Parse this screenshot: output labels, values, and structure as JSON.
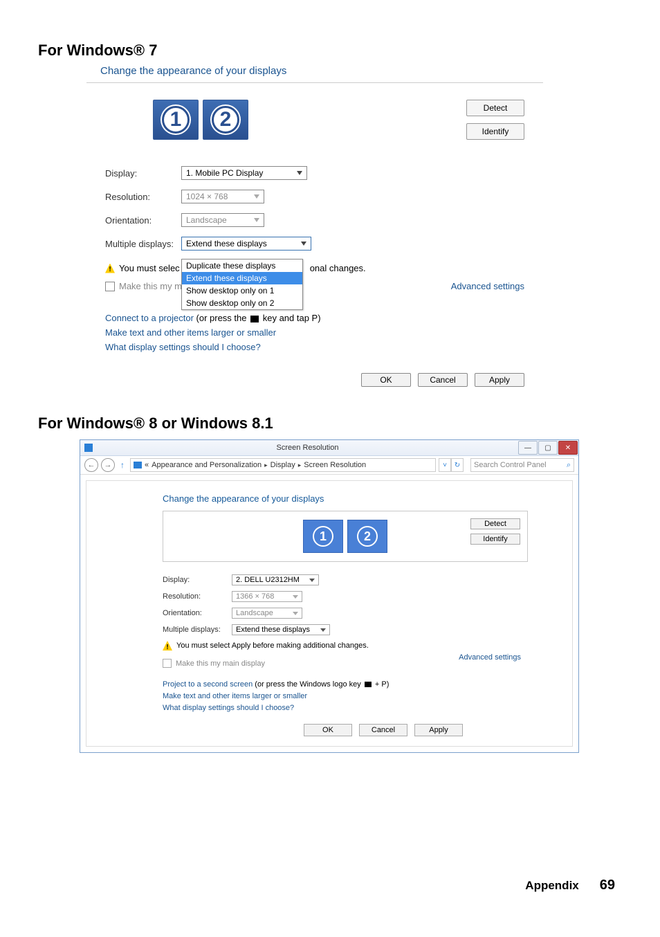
{
  "headings": {
    "win7": "For Windows® 7",
    "win8": "For Windows® 8 or Windows 8.1"
  },
  "win7": {
    "subtitle": "Change the appearance of your displays",
    "detect": "Detect",
    "identify": "Identify",
    "monitor1": "1",
    "monitor2": "2",
    "labels": {
      "display": "Display:",
      "resolution": "Resolution:",
      "orientation": "Orientation:",
      "multiple": "Multiple displays:"
    },
    "display_value": "1. Mobile PC Display",
    "resolution_value": "1024 × 768",
    "orientation_value": "Landscape",
    "multiple_value": "Extend these displays",
    "dropdown": {
      "opt1": "Duplicate these displays",
      "opt2": "Extend these displays",
      "opt3": "Show desktop only on 1",
      "opt4": "Show desktop only on 2"
    },
    "warn_behind1_left": "You must selec",
    "warn_behind1_right": "onal changes.",
    "warn_behind2_left": "Make this my m",
    "advanced": "Advanced settings",
    "link1a": "Connect to a projector",
    "link1b": " (or press the ",
    "link1c": " key and tap P)",
    "link2": "Make text and other items larger or smaller",
    "link3": "What display settings should I choose?",
    "ok": "OK",
    "cancel": "Cancel",
    "apply": "Apply"
  },
  "win8": {
    "window_title": "Screen Resolution",
    "breadcrumb_lead": "«",
    "breadcrumb": {
      "a": "Appearance and Personalization",
      "b": "Display",
      "c": "Screen Resolution"
    },
    "search_placeholder": "Search Control Panel",
    "subtitle": "Change the appearance of your displays",
    "detect": "Detect",
    "identify": "Identify",
    "monitor1": "1",
    "monitor2": "2",
    "labels": {
      "display": "Display:",
      "resolution": "Resolution:",
      "orientation": "Orientation:",
      "multiple": "Multiple displays:"
    },
    "display_value": "2. DELL U2312HM",
    "resolution_value": "1366 × 768",
    "orientation_value": "Landscape",
    "multiple_value": "Extend these displays",
    "warn": "You must select Apply before making additional changes.",
    "make_main": "Make this my main display",
    "advanced": "Advanced settings",
    "link1a": "Project to a second screen",
    "link1b": " (or press the Windows logo key ",
    "link1c": " + P)",
    "link2": "Make text and other items larger or smaller",
    "link3": "What display settings should I choose?",
    "ok": "OK",
    "cancel": "Cancel",
    "apply": "Apply"
  },
  "footer": {
    "label": "Appendix",
    "page": "69"
  }
}
